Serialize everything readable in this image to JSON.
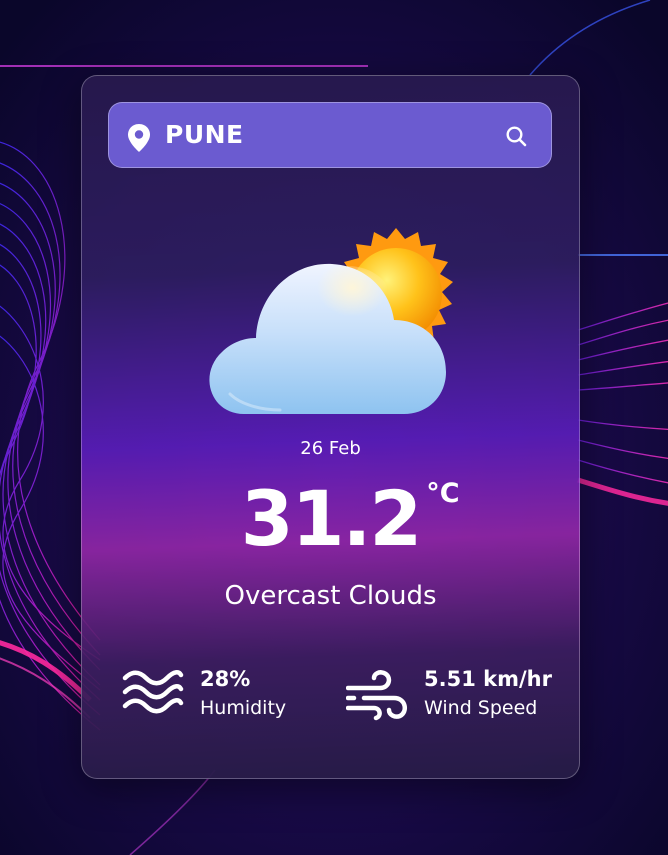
{
  "search": {
    "value": "PUNE"
  },
  "weather": {
    "date": "26 Feb",
    "temperature": "31.2",
    "unit": "°C",
    "condition": "Overcast Clouds",
    "icon": "partly-cloudy-sun-icon"
  },
  "stats": {
    "humidity": {
      "value": "28%",
      "label": "Humidity",
      "icon": "waves-icon"
    },
    "wind": {
      "value": "5.51 km/hr",
      "label": "Wind Speed",
      "icon": "wind-icon"
    }
  },
  "colors": {
    "background": "#0b0730",
    "search_bg": "#6b5bd0",
    "card_top": "#281a4e",
    "card_mid": "#5c1ebe",
    "accent_pink": "#e0207a"
  }
}
